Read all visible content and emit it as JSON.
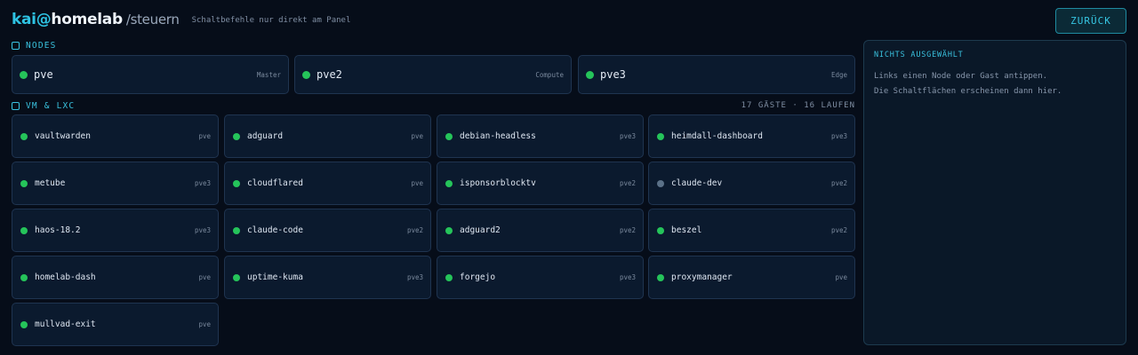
{
  "header": {
    "user": "kai",
    "at": "@",
    "host": "homelab",
    "path": "/steuern",
    "subtitle": "Schaltbefehle nur direkt am Panel",
    "back_label": "ZURÜCK"
  },
  "nodes_section": {
    "title": "NODES"
  },
  "nodes": [
    {
      "name": "pve",
      "role": "Master",
      "status": "online"
    },
    {
      "name": "pve2",
      "role": "Compute",
      "status": "online"
    },
    {
      "name": "pve3",
      "role": "Edge",
      "status": "online"
    }
  ],
  "guests_section": {
    "title": "VM & LXC",
    "count": "17 GÄSTE · 16 LAUFEN"
  },
  "guests": [
    {
      "name": "vaultwarden",
      "host": "pve",
      "status": "running"
    },
    {
      "name": "adguard",
      "host": "pve",
      "status": "running"
    },
    {
      "name": "debian-headless",
      "host": "pve3",
      "status": "running"
    },
    {
      "name": "heimdall-dashboard",
      "host": "pve3",
      "status": "running"
    },
    {
      "name": "metube",
      "host": "pve3",
      "status": "running"
    },
    {
      "name": "cloudflared",
      "host": "pve",
      "status": "running"
    },
    {
      "name": "isponsorblocktv",
      "host": "pve2",
      "status": "running"
    },
    {
      "name": "claude-dev",
      "host": "pve2",
      "status": "stopped"
    },
    {
      "name": "haos-18.2",
      "host": "pve3",
      "status": "running"
    },
    {
      "name": "claude-code",
      "host": "pve2",
      "status": "running"
    },
    {
      "name": "adguard2",
      "host": "pve2",
      "status": "running"
    },
    {
      "name": "beszel",
      "host": "pve2",
      "status": "running"
    },
    {
      "name": "homelab-dash",
      "host": "pve",
      "status": "running"
    },
    {
      "name": "uptime-kuma",
      "host": "pve3",
      "status": "running"
    },
    {
      "name": "forgejo",
      "host": "pve3",
      "status": "running"
    },
    {
      "name": "proxymanager",
      "host": "pve",
      "status": "running"
    },
    {
      "name": "mullvad-exit",
      "host": "pve",
      "status": "running"
    }
  ],
  "panel": {
    "title": "NICHTS AUSGEWÄHLT",
    "line1": "Links einen Node oder Gast antippen.",
    "line2": "Die Schaltflächen erscheinen dann hier."
  },
  "colors": {
    "accent": "#39c0dd",
    "running": "#25c45a",
    "stopped": "#5b7188",
    "background": "#060d19",
    "card": "#0b1a2e"
  }
}
